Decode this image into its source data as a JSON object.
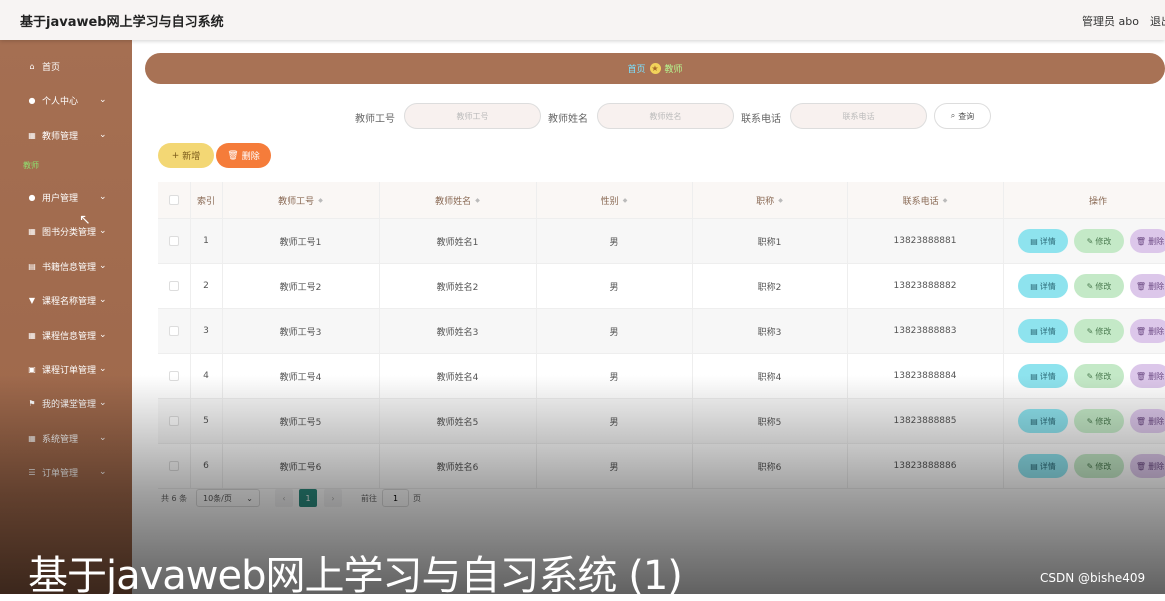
{
  "app": {
    "title": "基于javaweb网上学习与自习系统",
    "user": "管理员 abo",
    "logout": "退出"
  },
  "sidebar": {
    "items": [
      {
        "icon": "home-icon",
        "label": "首页",
        "arrow": ""
      },
      {
        "icon": "user-icon",
        "label": "个人中心",
        "arrow": "⌄"
      },
      {
        "icon": "grid-icon",
        "label": "教师管理",
        "arrow": "⌄"
      }
    ],
    "section": "教师",
    "items2": [
      {
        "icon": "user-icon",
        "label": "用户管理",
        "arrow": "⌄"
      },
      {
        "icon": "grid-icon",
        "label": "图书分类管理",
        "arrow": "⌄"
      },
      {
        "icon": "store-icon",
        "label": "书籍信息管理",
        "arrow": "⌄"
      },
      {
        "icon": "filter-icon",
        "label": "课程名称管理",
        "arrow": "⌄"
      },
      {
        "icon": "grid-icon",
        "label": "课程信息管理",
        "arrow": "⌄"
      },
      {
        "icon": "doc-icon",
        "label": "课程订单管理",
        "arrow": "⌄"
      },
      {
        "icon": "flag-icon",
        "label": "我的课堂管理",
        "arrow": "⌄"
      },
      {
        "icon": "grid-icon",
        "label": "系统管理",
        "arrow": "⌄"
      },
      {
        "icon": "list-icon",
        "label": "订单管理",
        "arrow": "⌄"
      }
    ]
  },
  "breadcrumb": {
    "home": "首页",
    "current": "教师"
  },
  "search": {
    "fields": [
      {
        "label": "教师工号",
        "placeholder": "教师工号"
      },
      {
        "label": "教师姓名",
        "placeholder": "教师姓名"
      },
      {
        "label": "联系电话",
        "placeholder": "联系电话"
      }
    ],
    "query": "查询"
  },
  "actions": {
    "add": "新增",
    "delete": "删除"
  },
  "table": {
    "headers": [
      "索引",
      "教师工号",
      "教师姓名",
      "性别",
      "职称",
      "联系电话",
      "操作"
    ],
    "rows": [
      [
        "1",
        "教师工号1",
        "教师姓名1",
        "男",
        "职称1",
        "13823888881"
      ],
      [
        "2",
        "教师工号2",
        "教师姓名2",
        "男",
        "职称2",
        "13823888882"
      ],
      [
        "3",
        "教师工号3",
        "教师姓名3",
        "男",
        "职称3",
        "13823888883"
      ],
      [
        "4",
        "教师工号4",
        "教师姓名4",
        "男",
        "职称4",
        "13823888884"
      ],
      [
        "5",
        "教师工号5",
        "教师姓名5",
        "男",
        "职称5",
        "13823888885"
      ],
      [
        "6",
        "教师工号6",
        "教师姓名6",
        "男",
        "职称6",
        "13823888886"
      ]
    ],
    "row_actions": {
      "detail": "详情",
      "edit": "修改",
      "delete": "删除"
    }
  },
  "pagination": {
    "total": "共 6 条",
    "page_size": "10条/页",
    "current": "1",
    "goto_label": "前往",
    "goto_value": "1",
    "page_unit": "页"
  },
  "caption": "基于javaweb网上学习与自习系统 (1)",
  "watermark": "CSDN @bishe409"
}
